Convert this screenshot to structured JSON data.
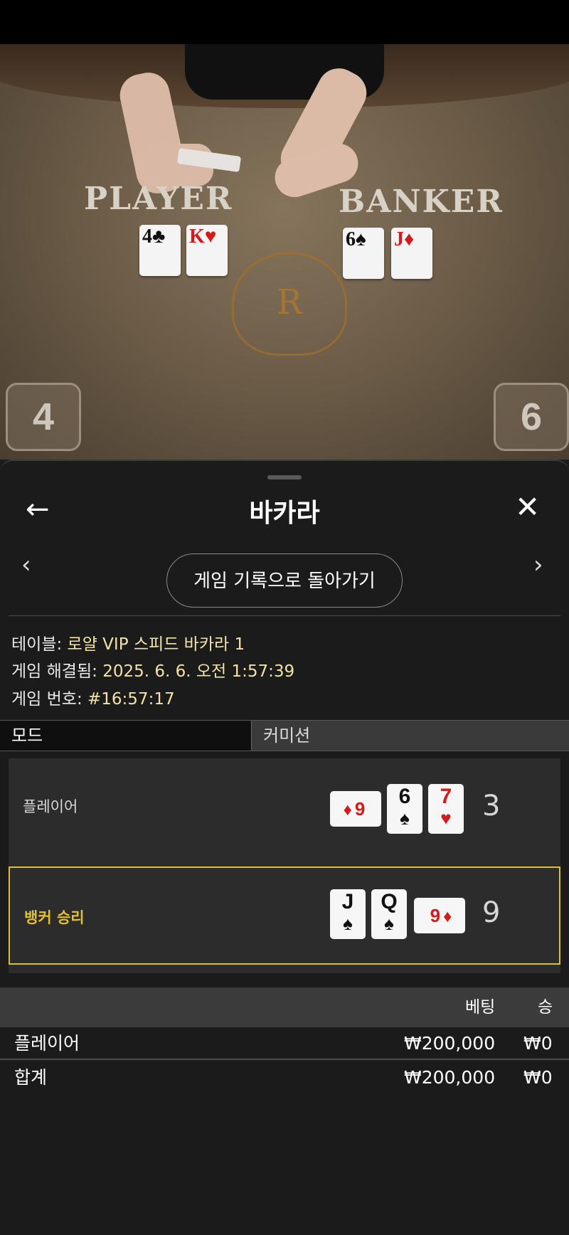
{
  "table_view": {
    "player_label": "PLAYER",
    "banker_label": "BANKER",
    "player_cards": [
      {
        "rank": "4",
        "suit": "♣"
      },
      {
        "rank": "K",
        "suit": "♥"
      }
    ],
    "banker_cards": [
      {
        "rank": "6",
        "suit": "♠"
      },
      {
        "rank": "J",
        "suit": "♦"
      }
    ],
    "crest_letter": "R",
    "player_score": "4",
    "banker_score": "6"
  },
  "header": {
    "title": "바카라",
    "back_icon": "←",
    "close_icon": "✕"
  },
  "nav": {
    "prev": "‹",
    "next": "›",
    "back_to_history": "게임 기록으로 돌아가기"
  },
  "info": {
    "table_label": "테이블:",
    "table_value": "로얄 VIP 스피드 바카라 1",
    "resolved_label": "게임 해결됨:",
    "resolved_value": "2025. 6. 6. 오전 1:57:39",
    "number_label": "게임 번호:",
    "number_value": "#16:57:17"
  },
  "tabs": {
    "mode": "모드",
    "commission": "커미션"
  },
  "result": {
    "player": {
      "label": "플레이어",
      "cards": [
        {
          "rank": "9",
          "suit": "♦"
        },
        {
          "rank": "6",
          "suit": "♠"
        },
        {
          "rank": "7",
          "suit": "♥"
        }
      ],
      "total": "3"
    },
    "banker": {
      "label": "뱅커 승리",
      "cards": [
        {
          "rank": "J",
          "suit": "♠"
        },
        {
          "rank": "Q",
          "suit": "♠"
        },
        {
          "rank": "9",
          "suit": "♦"
        }
      ],
      "total": "9"
    }
  },
  "bets": {
    "header_bet": "베팅",
    "header_win": "승",
    "rows": [
      {
        "name": "플레이어",
        "bet": "₩200,000",
        "win": "₩0"
      },
      {
        "name": "합계",
        "bet": "₩200,000",
        "win": "₩0"
      }
    ]
  },
  "colors": {
    "winner_accent": "#e1c12f",
    "info_value": "#f3e2a8",
    "card_red": "#d41a1a"
  }
}
